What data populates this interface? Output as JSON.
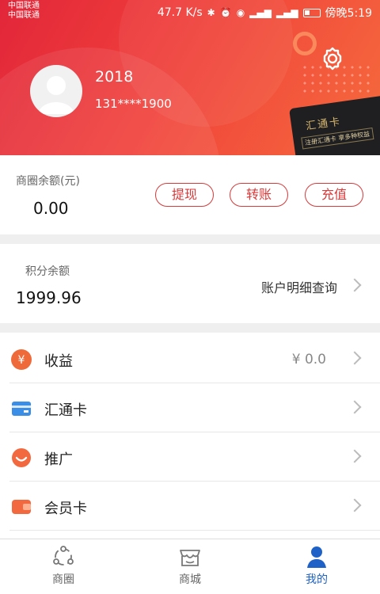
{
  "status_bar": {
    "carrier_1": "中国联通",
    "carrier_2": "中国联通",
    "speed": "47.7 K/s",
    "time": "傍晚5:19"
  },
  "profile": {
    "username": "2018",
    "phone": "131****1900"
  },
  "promo_card": {
    "title": "汇通卡",
    "subtitle": "注册汇通卡 享多种权益"
  },
  "balance": {
    "label": "商圈余额(元)",
    "value": "0.00",
    "withdraw_label": "提现",
    "transfer_label": "转账",
    "recharge_label": "充值"
  },
  "points": {
    "label": "积分余额",
    "value": "1999.96",
    "detail_link": "账户明细查询"
  },
  "menu": {
    "items": [
      {
        "label": "收益",
        "value": "¥  0.0",
        "icon": "yen-icon"
      },
      {
        "label": "汇通卡",
        "value": "",
        "icon": "card-icon"
      },
      {
        "label": "推广",
        "value": "",
        "icon": "promote-icon"
      },
      {
        "label": "会员卡",
        "value": "",
        "icon": "wallet-icon"
      }
    ]
  },
  "tabs": [
    {
      "label": "商圈",
      "icon": "network-icon",
      "active": false
    },
    {
      "label": "商城",
      "icon": "store-icon",
      "active": false
    },
    {
      "label": "我的",
      "icon": "person-icon",
      "active": true
    }
  ],
  "colors": {
    "brand_red": "#e2263a",
    "active_tab": "#1e62c8"
  }
}
